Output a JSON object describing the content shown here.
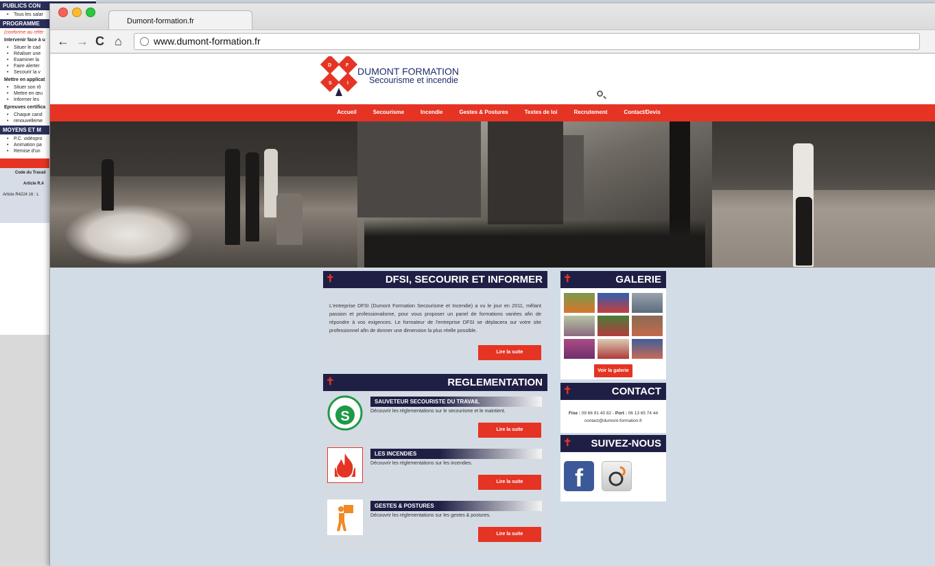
{
  "background_window": {
    "sections": [
      {
        "title": "PUBLICS CON",
        "items": [
          "Tous les salar"
        ]
      },
      {
        "title": "PROGRAMME",
        "note": "(conforme au référ"
      }
    ],
    "blocks": [
      {
        "heading": "Intervenir face à u",
        "items": [
          "Situer le cad",
          "Réaliser une",
          "Examiner la",
          "Faire alerter",
          "Secourir la v"
        ]
      },
      {
        "heading": "Mettre en applicat",
        "items": [
          "Situer son rô",
          "Mettre en œu",
          "Informer les"
        ]
      },
      {
        "heading": "Epreuves certifica",
        "items": [
          "Chaque cand",
          "renouvelleme"
        ]
      }
    ],
    "means": {
      "title": "MOYENS ET M",
      "items": [
        "P.C. vidéopro",
        "Animation pa",
        "Remise d'un"
      ]
    },
    "grey_lines": [
      "Code du Travail",
      "Article R.4",
      "Article R4224 16 : L"
    ]
  },
  "browser": {
    "tab_title": "Dumont-formation.fr",
    "url": "www.dumont-formation.fr",
    "nav_icons": [
      "back-arrow-icon",
      "forward-arrow-icon",
      "reload-icon",
      "home-icon"
    ]
  },
  "site": {
    "brand": {
      "name": "DUMONT FORMATION",
      "subtitle": "Secourisme et incendie",
      "logo_letters": [
        "D",
        "F",
        "S",
        "I"
      ]
    },
    "menu": [
      "Accueil",
      "Secourisme",
      "Incendie",
      "Gestes & Postures",
      "Textes de loi",
      "Recrutement",
      "Contact/Devis"
    ],
    "colors": {
      "red": "#e53424",
      "navy": "#1f1f45",
      "panel": "#d4dbe3"
    },
    "about": {
      "title": "DFSI, SECOURIR ET INFORMER",
      "text": "L'entreprise DFSI (Dumont Formation Secourisme et Incendie) a vu le jour en 2011, mêlant passion et professionalisme, pour vous proposer un panel de formations variées afin de répondre à vos exigences. Le formateur de l'entreprise DFSI se déplacera sur votre site professionnel afin de donner une dimension la plus réelle possible.",
      "button": "Lire la suite"
    },
    "regulation": {
      "title": "REGLEMENTATION",
      "items": [
        {
          "title": "SAUVETEUR SECOURISTE DU TRAVAIL",
          "desc": "Découvrir les réglementations sur le secourisme et le maintient.",
          "button": "Lire la suite",
          "icon": "sst-badge-icon"
        },
        {
          "title": "LES INCENDIES",
          "desc": "Découvrir les réglementations sur les incendies.",
          "button": "Lire la suite",
          "icon": "fire-icon"
        },
        {
          "title": "GESTES & POSTURES",
          "desc": "Découvrir les réglementations sur les gestes & postures.",
          "button": "Lire la suite",
          "icon": "lifting-box-icon"
        }
      ]
    },
    "gallery": {
      "title": "GALERIE",
      "button": "Voir la galerie"
    },
    "contact": {
      "title": "CONTACT",
      "fixe_label": "Fixe :",
      "fixe": "09 66 91 40 82",
      "port_label": "Port :",
      "port": "06 13 65 74 44",
      "email": "contact@dumont-formation.fr"
    },
    "social": {
      "title": "SUIVEZ-NOUS",
      "facebook_glyph": "f",
      "icons": [
        "facebook-icon",
        "viadeo-icon"
      ]
    }
  }
}
